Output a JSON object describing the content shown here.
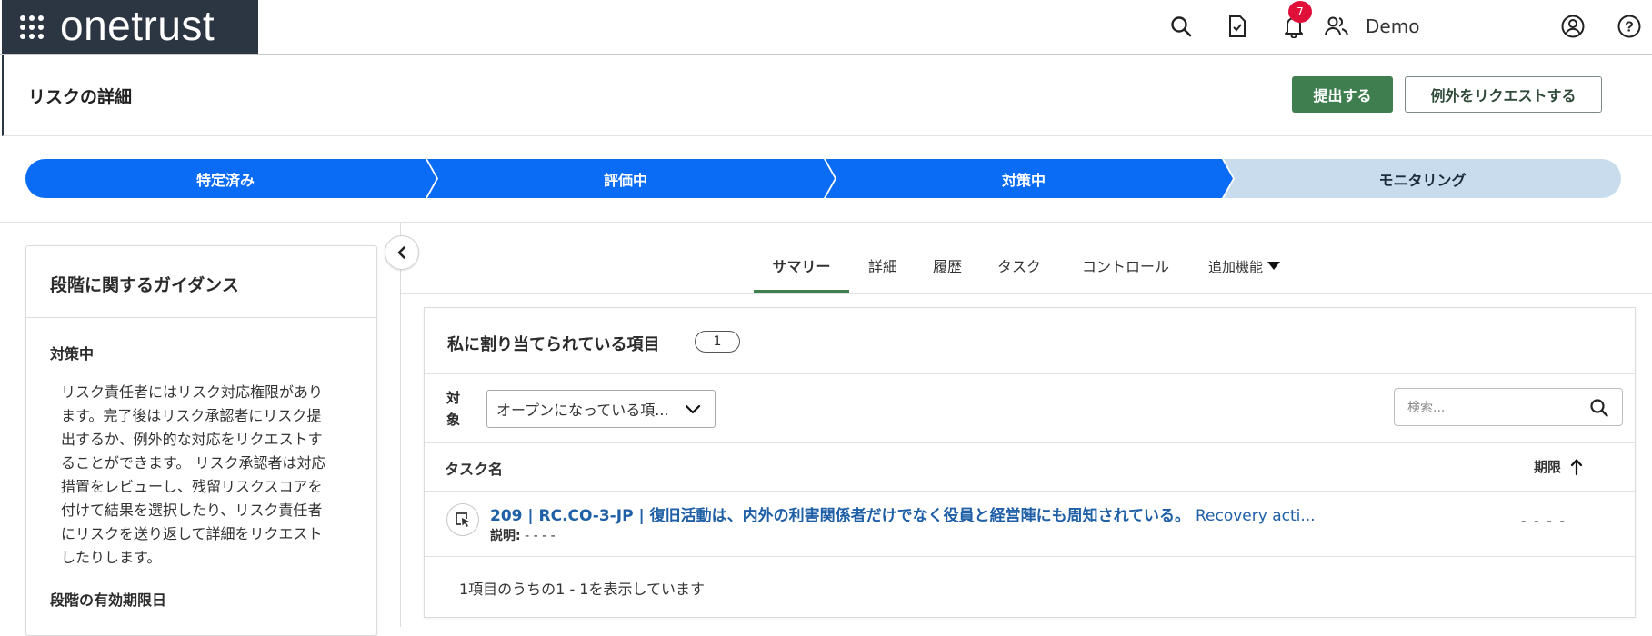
{
  "topbar": {
    "logo": "onetrust",
    "notification_count": "7",
    "user_name": "Demo",
    "icons": [
      "apps-grid-icon",
      "search-icon",
      "task-doc-icon",
      "bell-icon",
      "users-icon",
      "user-circle-icon",
      "help-icon"
    ]
  },
  "header": {
    "title": "リスクの詳細",
    "submit_label": "提出する",
    "exception_label": "例外をリクエストする"
  },
  "stages": [
    {
      "label": "特定済み",
      "status": "complete"
    },
    {
      "label": "評価中",
      "status": "complete"
    },
    {
      "label": "対策中",
      "status": "current"
    },
    {
      "label": "モニタリング",
      "status": "pending"
    }
  ],
  "colors": {
    "stage_active": "#0a6cf5",
    "stage_pending": "#c8dcee",
    "primary_green": "#3f7e4f",
    "link_blue": "#1f5fa6",
    "brand_dark": "#2c3542"
  },
  "guidance": {
    "title": "段階に関するガイダンス",
    "stage_name": "対策中",
    "lines": [
      "リスク責任者にはリスク対応権限があり",
      "ます。完了後はリスク承認者にリスク提",
      "出するか、例外的な対応をリクエストす",
      "ることができます。 リスク承認者は対応",
      "措置をレビューし、残留リスクスコアを",
      "付けて結果を選択したり、リスク責任者",
      "にリスクを送り返して詳細をリクエスト",
      "したりします。"
    ],
    "expiry_label": "段階の有効期限日"
  },
  "tabs": [
    {
      "label": "サマリー",
      "active": true
    },
    {
      "label": "詳細",
      "active": false
    },
    {
      "label": "履歴",
      "active": false
    },
    {
      "label": "タスク",
      "active": false
    },
    {
      "label": "コントロール",
      "active": false
    },
    {
      "label": "追加機能",
      "active": false
    }
  ],
  "assigned": {
    "title": "私に割り当てられている項目",
    "count": "1",
    "filter_label_line1": "対",
    "filter_label_line2": "象",
    "filter_value": "オープンになっている項...",
    "search_placeholder": "検索...",
    "col_task": "タスク名",
    "col_due": "期限",
    "rows": [
      {
        "title_jp": "209 | RC.CO-3-JP | 復旧活動は、内外の利害関係者だけでなく役員と経営陣にも周知されている。",
        "title_en": "Recovery acti...",
        "desc_label": "説明:",
        "desc_value": "- - - -",
        "due": "- - - -"
      }
    ],
    "footer": "1項目のうちの1 - 1を表示しています"
  }
}
